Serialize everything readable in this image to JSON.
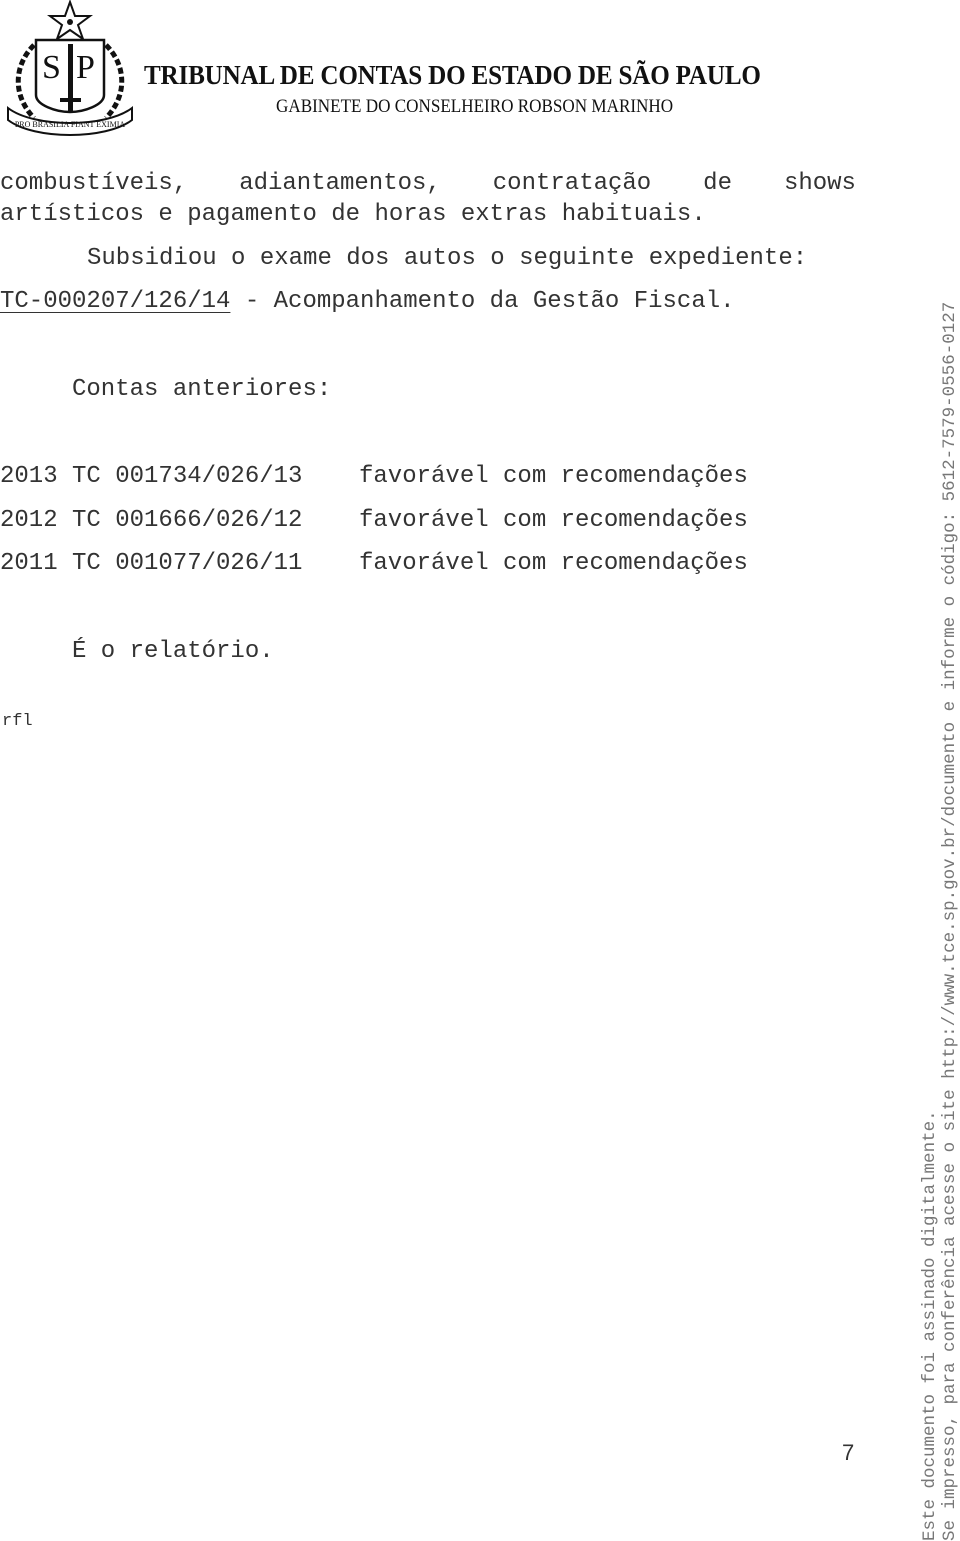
{
  "header": {
    "emblem_icon": "sao-paulo-coat-of-arms-icon",
    "emblem_letters": [
      "S",
      "P"
    ],
    "emblem_motto": "PRO BRASILIA FIANT EXIMIA",
    "title": "TRIBUNAL DE CONTAS DO ESTADO DE SÃO PAULO",
    "subtitle": "GABINETE DO CONSELHEIRO ROBSON MARINHO"
  },
  "body": {
    "line1_words": [
      "combustíveis,",
      "adiantamentos,",
      "contratação",
      "de",
      "shows"
    ],
    "line2": "artísticos e pagamento de horas extras habituais.",
    "line3": "Subsidiou o exame dos autos o seguinte expediente:",
    "line4_ref": "TC-000207/126/14",
    "line4_rest": " - Acompanhamento da Gestão Fiscal.",
    "previous_accounts_label": "Contas anteriores:",
    "previous_accounts": [
      {
        "year": "2013",
        "process": "TC 001734/026/13",
        "result": "favorável com recomendações"
      },
      {
        "year": "2012",
        "process": "TC 001666/026/12",
        "result": "favorável com recomendações"
      },
      {
        "year": "2011",
        "process": "TC 001077/026/11",
        "result": "favorável com recomendações"
      }
    ],
    "closing": "É o relatório.",
    "initials": "rfl"
  },
  "footer": {
    "page_number": "7"
  },
  "side_stamp": {
    "line1": "Este documento foi assinado digitalmente.",
    "line2": "Se impresso, para conferência acesse o site http://www.tce.sp.gov.br/documento e informe o código: 5612-7579-0556-0127"
  }
}
